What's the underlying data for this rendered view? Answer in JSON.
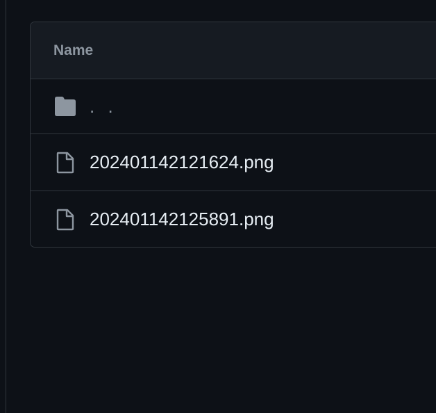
{
  "table": {
    "header": {
      "name_label": "Name"
    },
    "rows": [
      {
        "icon": "folder-icon",
        "label": ". ."
      },
      {
        "icon": "file-icon",
        "label": "202401142121624.png"
      },
      {
        "icon": "file-icon",
        "label": "202401142125891.png"
      }
    ]
  },
  "colors": {
    "background": "#0d1117",
    "header_background": "#161b22",
    "border": "#30363d",
    "muted_text": "#8d96a0",
    "text": "#e6edf3"
  }
}
